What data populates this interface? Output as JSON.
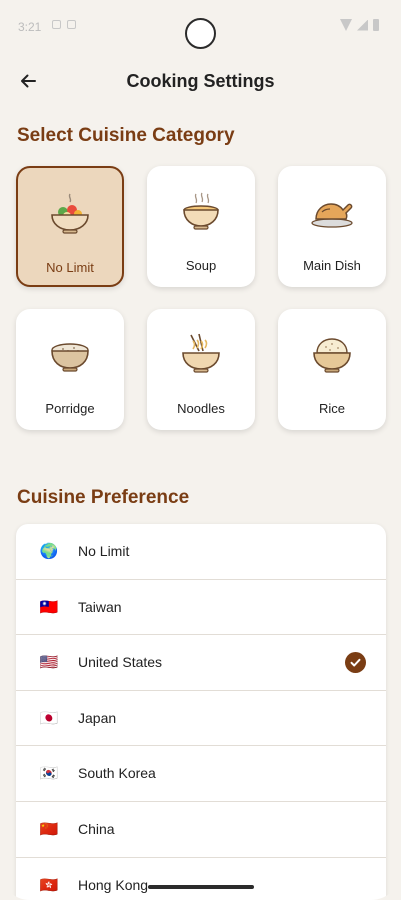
{
  "status": {
    "time": "3:21"
  },
  "header": {
    "title": "Cooking Settings"
  },
  "section_category": {
    "title": "Select Cuisine Category"
  },
  "categories": [
    {
      "label": "No Limit",
      "icon": "mixed-bowl-icon",
      "selected": true
    },
    {
      "label": "Soup",
      "icon": "soup-bowl-icon",
      "selected": false
    },
    {
      "label": "Main Dish",
      "icon": "roast-chicken-icon",
      "selected": false
    },
    {
      "label": "Porridge",
      "icon": "porridge-bowl-icon",
      "selected": false
    },
    {
      "label": "Noodles",
      "icon": "noodles-bowl-icon",
      "selected": false
    },
    {
      "label": "Rice",
      "icon": "rice-bowl-icon",
      "selected": false
    }
  ],
  "section_preference": {
    "title": "Cuisine Preference"
  },
  "preferences": [
    {
      "label": "No Limit",
      "flag": "🌍",
      "icon": "globe-icon",
      "selected": false
    },
    {
      "label": "Taiwan",
      "flag": "🇹🇼",
      "icon": "taiwan-flag-icon",
      "selected": false
    },
    {
      "label": "United States",
      "flag": "🇺🇸",
      "icon": "us-flag-icon",
      "selected": true
    },
    {
      "label": "Japan",
      "flag": "🇯🇵",
      "icon": "japan-flag-icon",
      "selected": false
    },
    {
      "label": "South Korea",
      "flag": "🇰🇷",
      "icon": "korea-flag-icon",
      "selected": false
    },
    {
      "label": "China",
      "flag": "🇨🇳",
      "icon": "china-flag-icon",
      "selected": false
    },
    {
      "label": "Hong Kong",
      "flag": "🇭🇰",
      "icon": "hongkong-flag-icon",
      "selected": false
    }
  ],
  "colors": {
    "accent": "#7a3d14",
    "selected_card_bg": "#ecd7bd",
    "background": "#f5f2ed"
  }
}
